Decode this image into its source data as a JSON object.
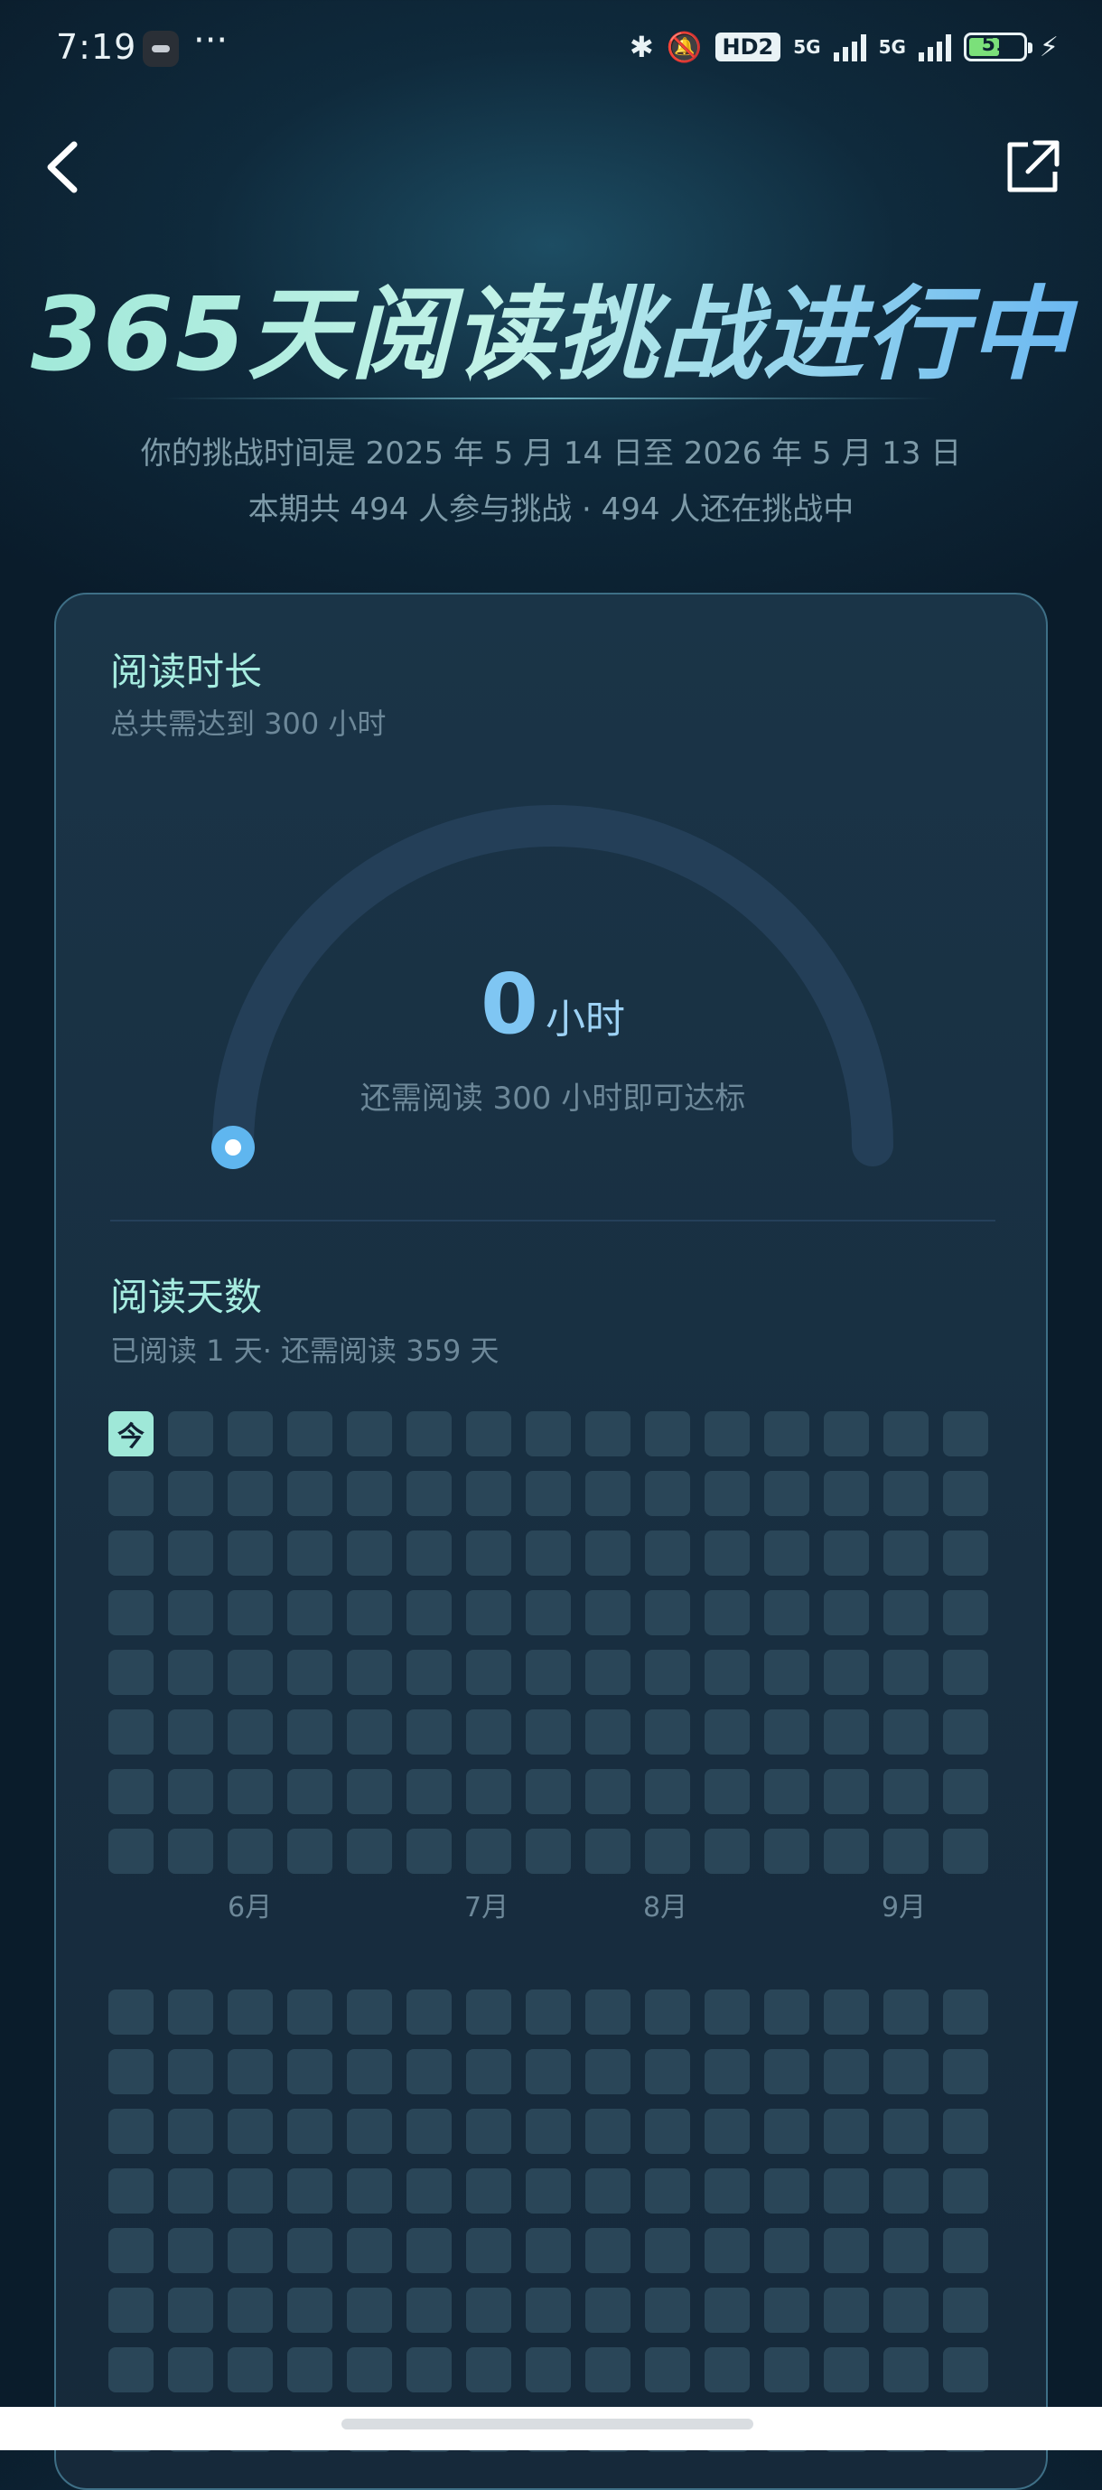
{
  "status_bar": {
    "time": "7:19",
    "more": "···",
    "hd_label": "HD2",
    "network1": "5G",
    "network2": "5G",
    "battery": "51"
  },
  "header": {
    "title": "365天阅读挑战进行中",
    "subtitle_line1": "你的挑战时间是 2025 年 5 月 14 日至 2026 年 5 月 13 日",
    "subtitle_line2": "本期共 494 人参与挑战 · 494 人还在挑战中"
  },
  "reading_time": {
    "title": "阅读时长",
    "subtitle": "总共需达到 300 小时",
    "value": "0",
    "unit": "小时",
    "hint": "还需阅读 300 小时即可达标",
    "progress": 0
  },
  "reading_days": {
    "title": "阅读天数",
    "subtitle": "已阅读 1 天· 还需阅读 359 天",
    "today_label": "今",
    "months": [
      "6月",
      "7月",
      "8月",
      "9月"
    ]
  },
  "colors": {
    "accent": "#9fe8d8",
    "gauge_track": "#243f58",
    "gauge_dot": "#5fb6ef",
    "cell": "#2a4658"
  }
}
